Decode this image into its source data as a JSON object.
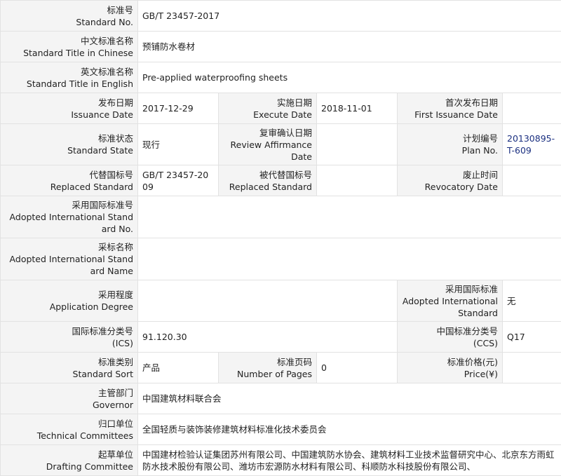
{
  "rows": {
    "standard_no": {
      "label_cn": "标准号",
      "label_en": "Standard No.",
      "value": "GB/T 23457-2017"
    },
    "title_cn": {
      "label_cn": "中文标准名称",
      "label_en": "Standard Title in Chinese",
      "value": "预铺防水卷材"
    },
    "title_en": {
      "label_cn": "英文标准名称",
      "label_en": "Standard Title in English",
      "value": "Pre-applied waterproofing sheets"
    },
    "issuance_date": {
      "label_cn": "发布日期",
      "label_en": "Issuance Date",
      "value": "2017-12-29"
    },
    "execute_date": {
      "label_cn": "实施日期",
      "label_en": "Execute Date",
      "value": "2018-11-01"
    },
    "first_issuance_date": {
      "label_cn": "首次发布日期",
      "label_en": "First Issuance Date",
      "value": ""
    },
    "standard_state": {
      "label_cn": "标准状态",
      "label_en": "Standard State",
      "value": "现行"
    },
    "review_affirmance_date": {
      "label_cn": "复审确认日期",
      "label_en": "Review Affirmance Date",
      "value": ""
    },
    "plan_no": {
      "label_cn": "计划编号",
      "label_en": "Plan No.",
      "value": "20130895-T-609"
    },
    "replaced_standard": {
      "label_cn": "代替国标号",
      "label_en": "Replaced Standard",
      "value": "GB/T 23457-2009"
    },
    "replaced_by": {
      "label_cn": "被代替国标号",
      "label_en": "Replaced Standard",
      "value": ""
    },
    "revocatory_date": {
      "label_cn": "废止时间",
      "label_en": "Revocatory Date",
      "value": ""
    },
    "adopted_intl_no": {
      "label_cn": "采用国际标准号",
      "label_en": "Adopted International Standard No.",
      "value": ""
    },
    "adopted_intl_name": {
      "label_cn": "采标名称",
      "label_en": "Adopted International Standard Name",
      "value": ""
    },
    "application_degree": {
      "label_cn": "采用程度",
      "label_en": "Application Degree",
      "value": ""
    },
    "adopted_intl_standard": {
      "label_cn": "采用国际标准",
      "label_en": "Adopted International Standard",
      "value": "无"
    },
    "ics": {
      "label_cn": "国际标准分类号",
      "label_en": "(ICS)",
      "value": "91.120.30"
    },
    "ccs": {
      "label_cn": "中国标准分类号",
      "label_en": "(CCS)",
      "value": "Q17"
    },
    "standard_sort": {
      "label_cn": "标准类别",
      "label_en": "Standard Sort",
      "value": "产品"
    },
    "number_of_pages": {
      "label_cn": "标准页码",
      "label_en": "Number of Pages",
      "value": "0"
    },
    "price": {
      "label_cn": "标准价格(元)",
      "label_en": "Price(¥)",
      "value": ""
    },
    "governor": {
      "label_cn": "主管部门",
      "label_en": "Governor",
      "value": "中国建筑材料联合会"
    },
    "technical_committees": {
      "label_cn": "归口单位",
      "label_en": "Technical Committees",
      "value": "全国轻质与装饰装修建筑材料标准化技术委员会"
    },
    "drafting_committee": {
      "label_cn": "起草单位",
      "label_en": "Drafting Committee",
      "value": "中国建材检验认证集团苏州有限公司、中国建筑防水协会、建筑材料工业技术监督研究中心、北京东方雨虹防水技术股份有限公司、潍坊市宏源防水材料有限公司、科顺防水科技股份有限公司、"
    }
  }
}
